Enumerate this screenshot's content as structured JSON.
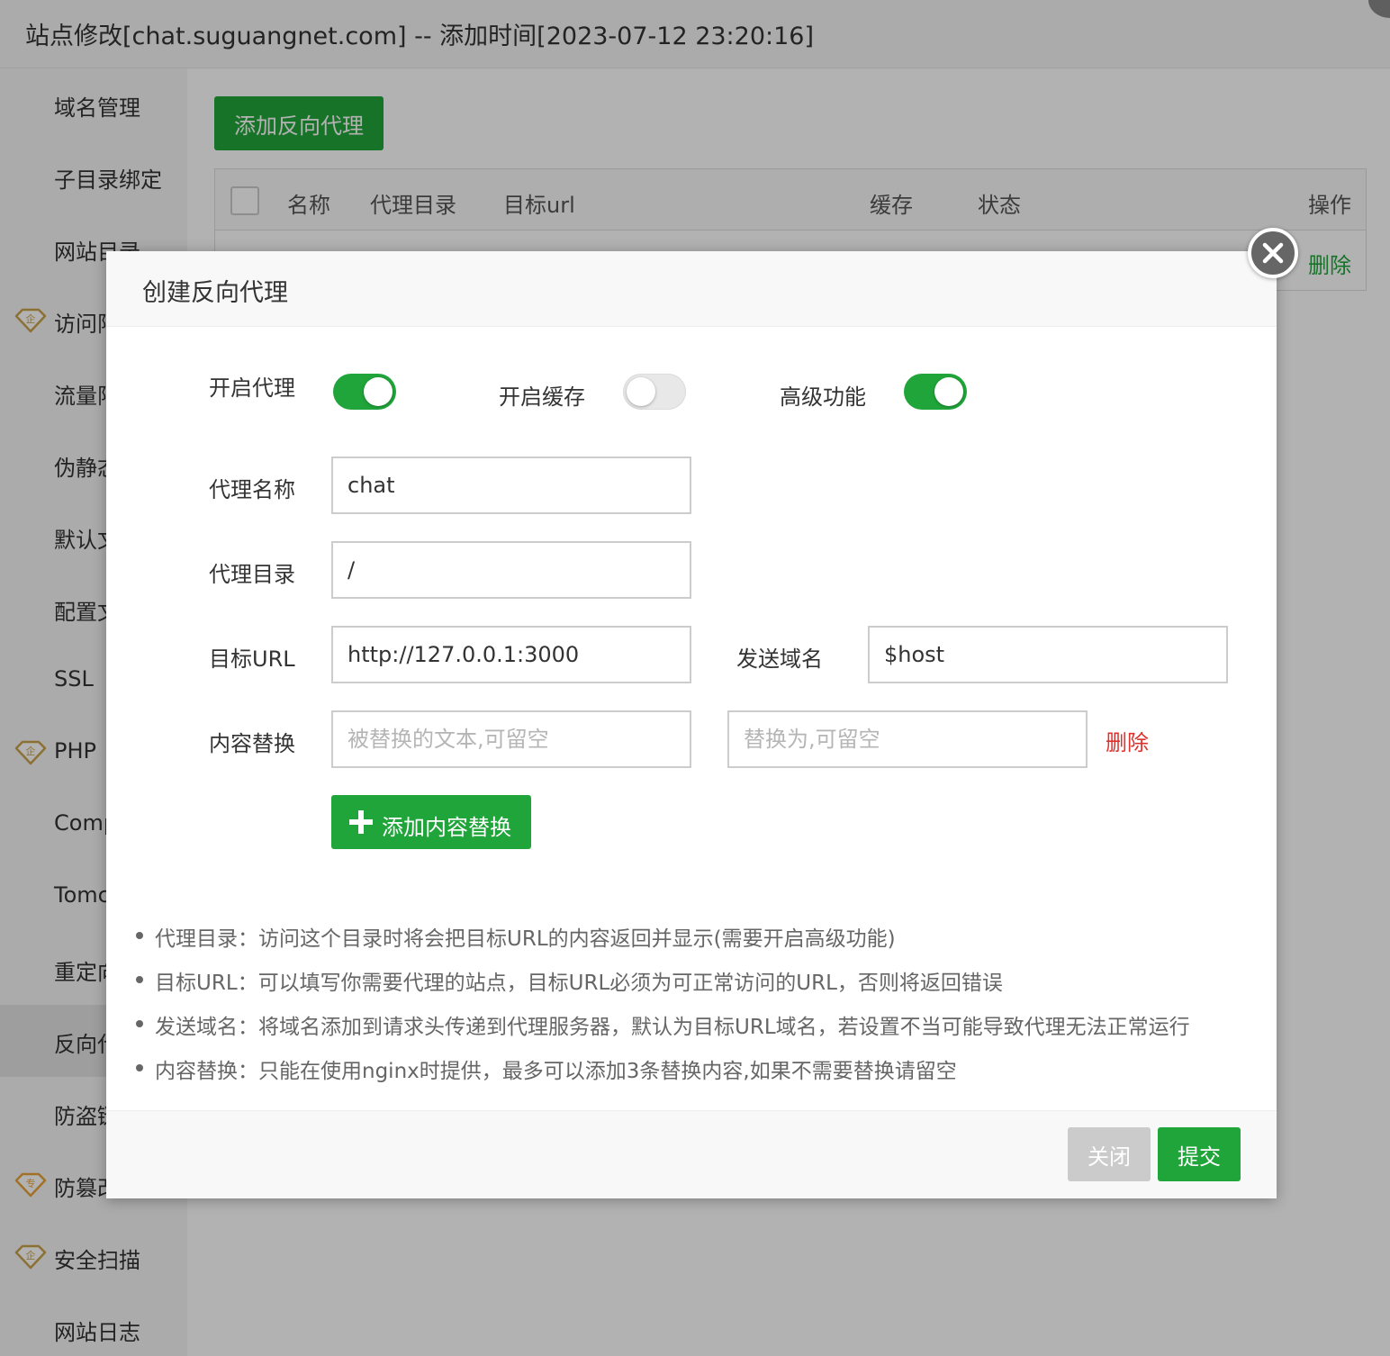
{
  "window": {
    "title": "站点修改[chat.suguangnet.com] -- 添加时间[2023-07-12 23:20:16]"
  },
  "sidebar": {
    "items": [
      {
        "label": "域名管理",
        "badge": ""
      },
      {
        "label": "子目录绑定",
        "badge": ""
      },
      {
        "label": "网站目录",
        "badge": ""
      },
      {
        "label": "访问限制",
        "badge": "企"
      },
      {
        "label": "流量限制",
        "badge": ""
      },
      {
        "label": "伪静态",
        "badge": ""
      },
      {
        "label": "默认文档",
        "badge": ""
      },
      {
        "label": "配置文件",
        "badge": ""
      },
      {
        "label": "SSL",
        "badge": ""
      },
      {
        "label": "PHP",
        "badge": "企"
      },
      {
        "label": "Composer",
        "badge": ""
      },
      {
        "label": "Tomcat",
        "badge": ""
      },
      {
        "label": "重定向",
        "badge": ""
      },
      {
        "label": "反向代理",
        "badge": "",
        "active": true
      },
      {
        "label": "防盗链",
        "badge": ""
      },
      {
        "label": "防篡改",
        "badge": "专"
      },
      {
        "label": "安全扫描",
        "badge": "企"
      },
      {
        "label": "网站日志",
        "badge": ""
      }
    ]
  },
  "main": {
    "add_proxy_label": "添加反向代理",
    "table": {
      "columns": [
        "名称",
        "代理目录",
        "目标url",
        "缓存",
        "状态",
        "操作"
      ],
      "rows": [
        {
          "action": "删除"
        }
      ]
    }
  },
  "dialog": {
    "title": "创建反向代理",
    "toggles": [
      {
        "label": "开启代理",
        "on": true
      },
      {
        "label": "开启缓存",
        "on": false
      },
      {
        "label": "高级功能",
        "on": true
      }
    ],
    "fields": {
      "proxy_name": {
        "label": "代理名称",
        "value": "chat"
      },
      "proxy_dir": {
        "label": "代理目录",
        "value": "/"
      },
      "target_url": {
        "label": "目标URL",
        "value": "http://127.0.0.1:3000"
      },
      "send_domain": {
        "label": "发送域名",
        "value": "$host"
      },
      "replace": {
        "label": "内容替换",
        "from_placeholder": "被替换的文本,可留空",
        "to_placeholder": "替换为,可留空",
        "delete_label": "删除"
      }
    },
    "add_replace_label": "添加内容替换",
    "tips": [
      "代理目录：访问这个目录时将会把目标URL的内容返回并显示(需要开启高级功能)",
      "目标URL：可以填写你需要代理的站点，目标URL必须为可正常访问的URL，否则将返回错误",
      "发送域名：将域名添加到请求头传递到代理服务器，默认为目标URL域名，若设置不当可能导致代理无法正常运行",
      "内容替换：只能在使用nginx时提供，最多可以添加3条替换内容,如果不需要替换请留空"
    ],
    "close_label": "关闭",
    "submit_label": "提交"
  },
  "colors": {
    "accent": "#20a53a",
    "danger": "#e0302b",
    "badge": "#c9a24d"
  }
}
